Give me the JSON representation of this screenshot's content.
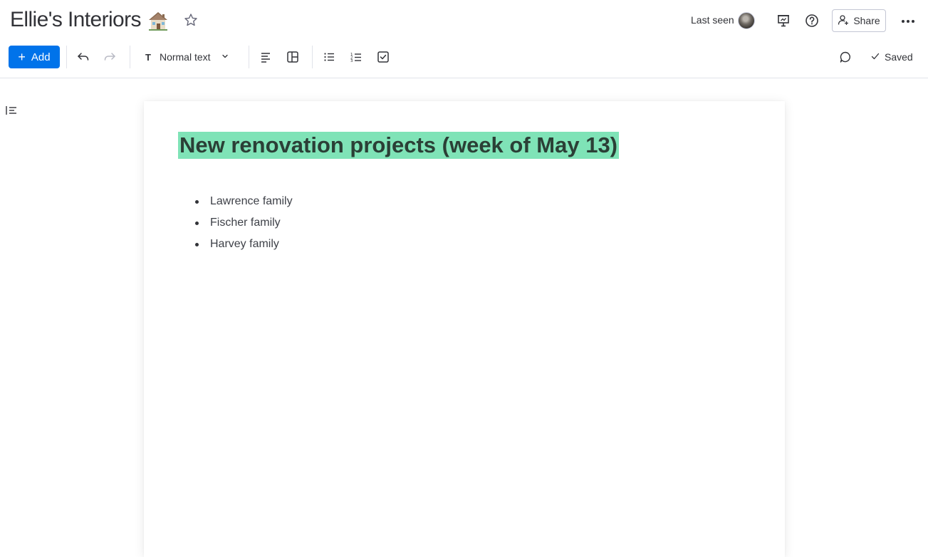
{
  "header": {
    "board_title": "Ellie's Interiors",
    "title_emoji": "house-icon",
    "last_seen_label": "Last seen",
    "share_label": "Share"
  },
  "toolbar": {
    "add_label": "Add",
    "text_style_value": "Normal text",
    "saved_label": "Saved"
  },
  "document": {
    "heading": "New renovation projects (week of May 13)",
    "heading_highlight_color": "#7fe3b7",
    "list_items": [
      "Lawrence family",
      "Fischer family",
      "Harvey family"
    ]
  },
  "colors": {
    "accent": "#0073ea",
    "text": "#323338",
    "border": "#e1e3ea"
  }
}
